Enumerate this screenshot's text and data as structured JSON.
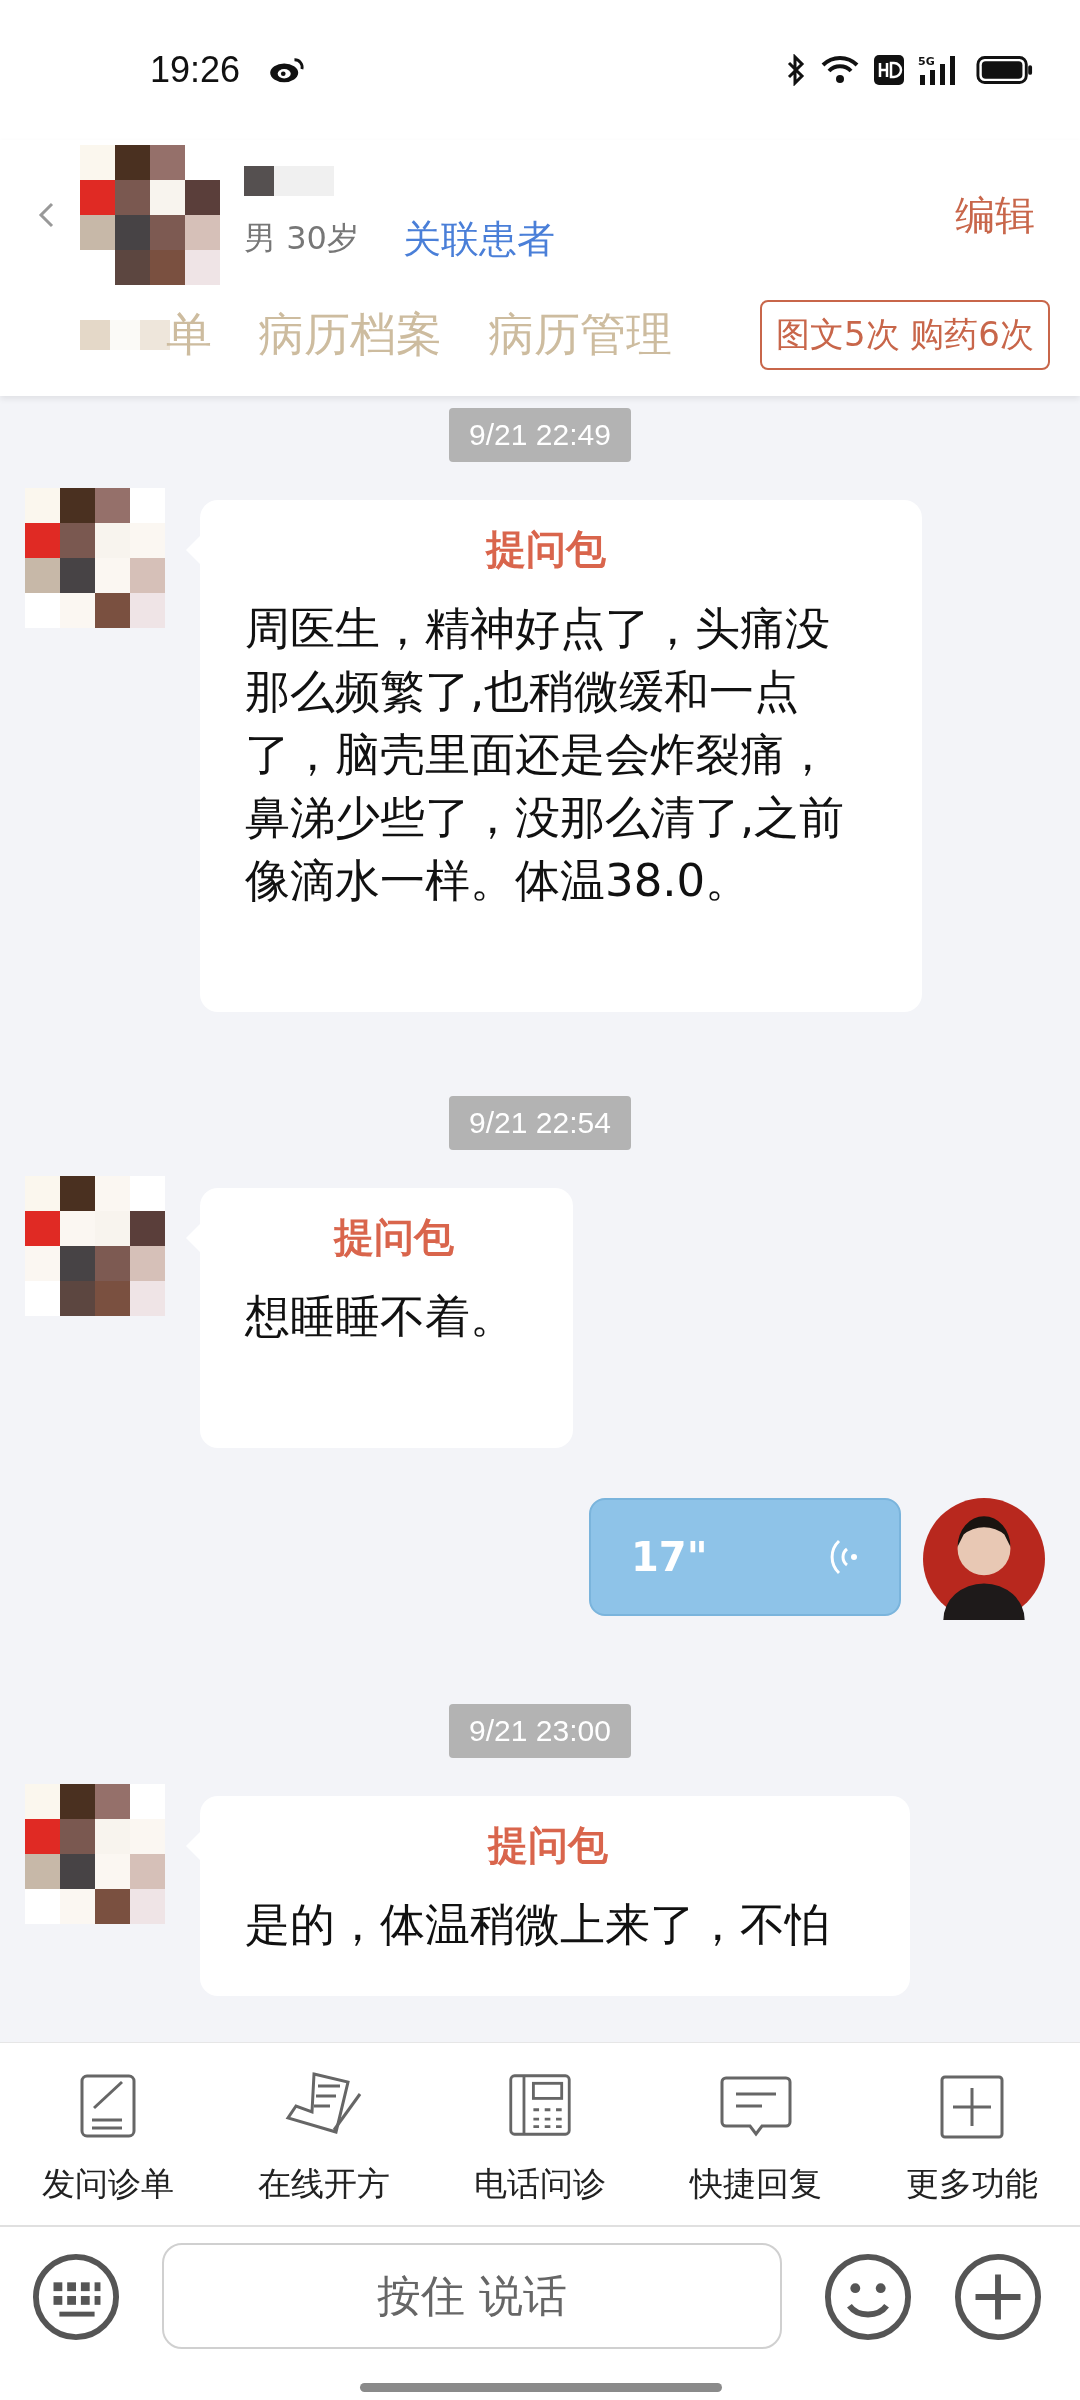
{
  "status_bar": {
    "time": "19:26",
    "network": "5G"
  },
  "header": {
    "patient_meta": "男 30岁",
    "link_label": "关联患者",
    "edit_label": "编辑",
    "tabs": [
      {
        "label": "单",
        "selected": false
      },
      {
        "label": "病历档案",
        "selected": false
      },
      {
        "label": "病历管理",
        "selected": false
      }
    ],
    "usage_badge": "图文5次 购药6次"
  },
  "messages": [
    {
      "kind": "time",
      "text": "9/21 22:49"
    },
    {
      "kind": "question",
      "title": "提问包",
      "text": "周医生，精神好点了，头痛没那么频繁了,也稍微缓和一点了，脑壳里面还是会炸裂痛，鼻涕少些了，没那么清了,之前像滴水一样。体温38.0。"
    },
    {
      "kind": "time",
      "text": "9/21 22:54"
    },
    {
      "kind": "question",
      "title": "提问包",
      "text": "想睡睡不着。"
    },
    {
      "kind": "voice",
      "duration": "17\""
    },
    {
      "kind": "time",
      "text": "9/21 23:00"
    },
    {
      "kind": "question",
      "title": "提问包",
      "text": "是的，体温稍微上来了，不怕"
    }
  ],
  "toolbar": [
    {
      "kind": "form",
      "label": "发问诊单"
    },
    {
      "kind": "prescription",
      "label": "在线开方"
    },
    {
      "kind": "phone",
      "label": "电话问诊"
    },
    {
      "kind": "reply",
      "label": "快捷回复"
    },
    {
      "kind": "more",
      "label": "更多功能"
    }
  ],
  "input": {
    "hold_label": "按住 说话"
  }
}
